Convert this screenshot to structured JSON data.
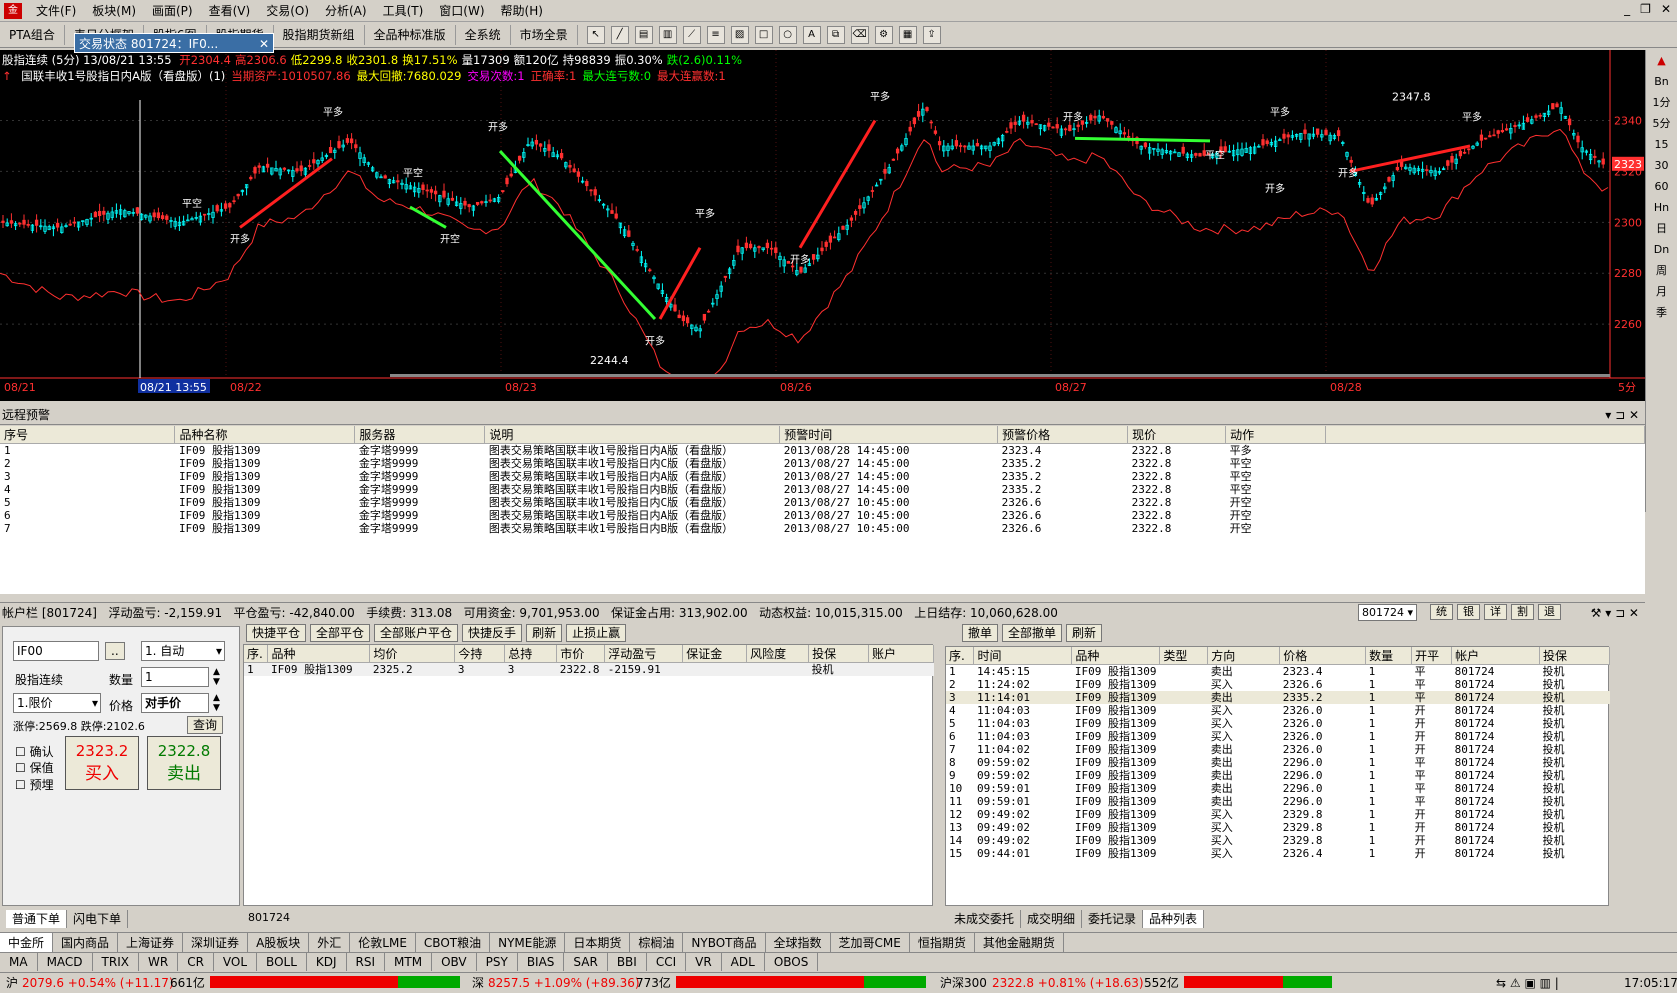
{
  "app": {
    "menus": [
      "文件(F)",
      "板块(M)",
      "画面(P)",
      "查看(V)",
      "交易(O)",
      "分析(A)",
      "工具(T)",
      "窗口(W)",
      "帮助(H)"
    ]
  },
  "toolbar": {
    "tabs": [
      "PTA组合",
      "表日分框架",
      "股指6图",
      "股指期货",
      "股指期货新组",
      "全品种标准版",
      "全系统",
      "市场全景"
    ]
  },
  "popup": {
    "title": "交易状态 801724：IF0..."
  },
  "chart": {
    "info1": "股指连续 (5分) 13/08/21 13:55",
    "info1_vals": [
      "开2304.4",
      "高2306.6",
      "低2299.8",
      "收2301.8",
      "换17.51%",
      "量17309",
      "额120亿",
      "持98839",
      "振0.30%",
      "跌(2.6)0.11%"
    ],
    "info2_vals": [
      "国联丰收1号股指日内A版（看盘版）(1)",
      "当期资产:1010507.86",
      "最大回撤:7680.029",
      "交易次数:1",
      "正确率:1",
      "最大连亏数:0",
      "最大连赢数:1"
    ],
    "price_labels": [
      "2340",
      "2320",
      "2300",
      "2280",
      "2260"
    ],
    "current_price": "2323",
    "date_labels": [
      "08/21",
      "08/21 13:55",
      "08/22",
      "08/23",
      "08/26",
      "08/27",
      "08/28",
      "5分"
    ],
    "annotations": [
      "平空",
      "开多",
      "平多",
      "开空",
      "2244.4",
      "2347.8"
    ],
    "colors": {
      "up": "#00ffff",
      "down": "#ff3030",
      "long": "#ff2020",
      "short": "#33ff33"
    }
  },
  "rightbar": [
    "Bn",
    "1分",
    "5分",
    "15",
    "30",
    "60",
    "Hn",
    "日",
    "Dn",
    "周",
    "月",
    "季"
  ],
  "alerts": {
    "title": "远程预警",
    "columns": [
      "序号",
      "品种名称",
      "服务器",
      "说明",
      "预警时间",
      "预警价格",
      "现价",
      "动作"
    ],
    "rows": [
      [
        "1",
        "IF09 股指1309",
        "金字塔9999",
        "图表交易策略国联丰收1号股指日内A版（看盘版）",
        "2013/08/28 14:45:00",
        "2323.4",
        "2322.8",
        "平多"
      ],
      [
        "2",
        "IF09 股指1309",
        "金字塔9999",
        "图表交易策略国联丰收1号股指日内C版（看盘版）",
        "2013/08/27 14:45:00",
        "2335.2",
        "2322.8",
        "平空"
      ],
      [
        "3",
        "IF09 股指1309",
        "金字塔9999",
        "图表交易策略国联丰收1号股指日内A版（看盘版）",
        "2013/08/27 14:45:00",
        "2335.2",
        "2322.8",
        "平空"
      ],
      [
        "4",
        "IF09 股指1309",
        "金字塔9999",
        "图表交易策略国联丰收1号股指日内B版（看盘版）",
        "2013/08/27 14:45:00",
        "2335.2",
        "2322.8",
        "平空"
      ],
      [
        "5",
        "IF09 股指1309",
        "金字塔9999",
        "图表交易策略国联丰收1号股指日内C版（看盘版）",
        "2013/08/27 10:45:00",
        "2326.6",
        "2322.8",
        "开空"
      ],
      [
        "6",
        "IF09 股指1309",
        "金字塔9999",
        "图表交易策略国联丰收1号股指日内A版（看盘版）",
        "2013/08/27 10:45:00",
        "2326.6",
        "2322.8",
        "开空"
      ],
      [
        "7",
        "IF09 股指1309",
        "金字塔9999",
        "图表交易策略国联丰收1号股指日内B版（看盘版）",
        "2013/08/27 10:45:00",
        "2326.6",
        "2322.8",
        "开空"
      ]
    ]
  },
  "account": {
    "text": "帐户栏 [801724]",
    "float": "浮动盈亏: -2,159.91",
    "close": "平仓盈亏: -42,840.00",
    "fee": "手续费: 313.08",
    "avail": "可用资金: 9,701,953.00",
    "margin": "保证金占用: 313,902.00",
    "equity": "动态权益: 10,015,315.00",
    "prev": "上日结存: 10,060,628.00",
    "acct_sel": "801724",
    "btns": [
      "统",
      "银",
      "详",
      "割",
      "退"
    ]
  },
  "order": {
    "code": "IF00",
    "mode": "1. 自动",
    "name": "股指连续",
    "qty_label": "数量",
    "qty": "1",
    "pricetype": "1.限价",
    "price_label": "价格",
    "price": "对手价",
    "limits": "涨停:2569.8 跌停:2102.6",
    "query": "查询",
    "confirm": "确认",
    "hedge": "保值",
    "pre": "预埋",
    "buy_price": "2323.2",
    "buy": "买入",
    "sell_price": "2322.8",
    "sell": "卖出",
    "tabs": [
      "普通下单",
      "闪电下单"
    ]
  },
  "positions": {
    "btns": [
      "快捷平仓",
      "全部平仓",
      "全部账户平仓",
      "快捷反手",
      "刷新",
      "止损止赢"
    ],
    "columns": [
      "序.",
      "品种",
      "均价",
      "今持",
      "总持",
      "市价",
      "浮动盈亏",
      "保证金",
      "风险度",
      "投保",
      "账户"
    ],
    "rows": [
      [
        "1",
        "IF09 股指1309",
        "2325.2",
        "3",
        "3",
        "2322.8",
        "-2159.91",
        "",
        "",
        "投机",
        ""
      ]
    ],
    "footer": "801724"
  },
  "trades": {
    "btns": [
      "撤单",
      "全部撤单",
      "刷新"
    ],
    "columns": [
      "序.",
      "时间",
      "品种",
      "类型",
      "方向",
      "价格",
      "数量",
      "开平",
      "帐户",
      "投保"
    ],
    "rows": [
      [
        "1",
        "14:45:15",
        "IF09 股指1309",
        "",
        "卖出",
        "2323.4",
        "1",
        "平",
        "801724",
        "投机"
      ],
      [
        "2",
        "11:24:02",
        "IF09 股指1309",
        "",
        "买入",
        "2326.6",
        "1",
        "平",
        "801724",
        "投机"
      ],
      [
        "3",
        "11:14:01",
        "IF09 股指1309",
        "",
        "卖出",
        "2335.2",
        "1",
        "平",
        "801724",
        "投机"
      ],
      [
        "4",
        "11:04:03",
        "IF09 股指1309",
        "",
        "买入",
        "2326.0",
        "1",
        "开",
        "801724",
        "投机"
      ],
      [
        "5",
        "11:04:03",
        "IF09 股指1309",
        "",
        "买入",
        "2326.0",
        "1",
        "开",
        "801724",
        "投机"
      ],
      [
        "6",
        "11:04:03",
        "IF09 股指1309",
        "",
        "买入",
        "2326.0",
        "1",
        "开",
        "801724",
        "投机"
      ],
      [
        "7",
        "11:04:02",
        "IF09 股指1309",
        "",
        "卖出",
        "2326.0",
        "1",
        "开",
        "801724",
        "投机"
      ],
      [
        "8",
        "09:59:02",
        "IF09 股指1309",
        "",
        "卖出",
        "2296.0",
        "1",
        "平",
        "801724",
        "投机"
      ],
      [
        "9",
        "09:59:02",
        "IF09 股指1309",
        "",
        "卖出",
        "2296.0",
        "1",
        "平",
        "801724",
        "投机"
      ],
      [
        "10",
        "09:59:01",
        "IF09 股指1309",
        "",
        "卖出",
        "2296.0",
        "1",
        "平",
        "801724",
        "投机"
      ],
      [
        "11",
        "09:59:01",
        "IF09 股指1309",
        "",
        "卖出",
        "2296.0",
        "1",
        "平",
        "801724",
        "投机"
      ],
      [
        "12",
        "09:49:02",
        "IF09 股指1309",
        "",
        "买入",
        "2329.8",
        "1",
        "开",
        "801724",
        "投机"
      ],
      [
        "13",
        "09:49:02",
        "IF09 股指1309",
        "",
        "买入",
        "2329.8",
        "1",
        "开",
        "801724",
        "投机"
      ],
      [
        "14",
        "09:49:02",
        "IF09 股指1309",
        "",
        "买入",
        "2329.8",
        "1",
        "开",
        "801724",
        "投机"
      ],
      [
        "15",
        "09:44:01",
        "IF09 股指1309",
        "",
        "买入",
        "2326.4",
        "1",
        "开",
        "801724",
        "投机"
      ]
    ],
    "tabs": [
      "未成交委托",
      "成交明细",
      "委托记录",
      "品种列表"
    ]
  },
  "markets": [
    "中金所",
    "国内商品",
    "上海证券",
    "深圳证券",
    "A股板块",
    "外汇",
    "伦敦LME",
    "CBOT粮油",
    "NYME能源",
    "日本期货",
    "棕榈油",
    "NYBOT商品",
    "全球指数",
    "芝加哥CME",
    "恒指期货",
    "其他金融期货"
  ],
  "indicators": [
    "MA",
    "MACD",
    "TRIX",
    "WR",
    "CR",
    "VOL",
    "BOLL",
    "KDJ",
    "RSI",
    "MTM",
    "OBV",
    "PSY",
    "BIAS",
    "SAR",
    "BBI",
    "CCI",
    "VR",
    "ADL",
    "OBOS"
  ],
  "status": {
    "sh": "沪",
    "sh_val": "2079.6 +0.54% (+11.17)",
    "sh_amt": "661亿",
    "sz": "深",
    "sz_val": "8257.5 +1.09% (+89.36)",
    "sz_amt": "773亿",
    "hs": "沪深300",
    "hs_val": "2322.8 +0.81% (+18.63)",
    "hs_amt": "552亿",
    "time": "17:05:17"
  }
}
